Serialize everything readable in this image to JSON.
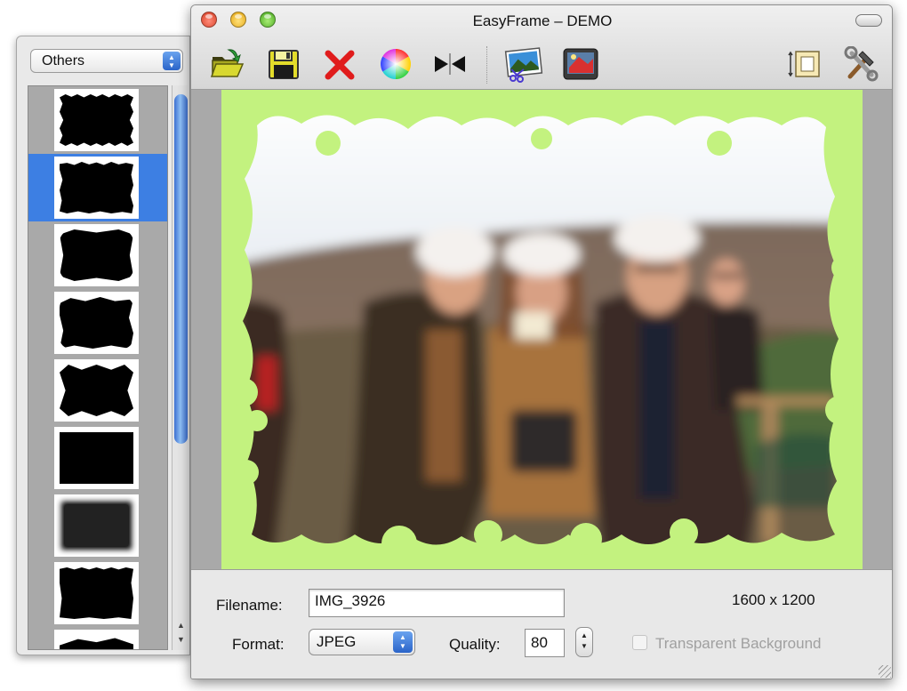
{
  "window": {
    "title": "EasyFrame – DEMO"
  },
  "drawer": {
    "category_selected": "Others",
    "frames": [
      {
        "name": "frame-thumb-1"
      },
      {
        "name": "frame-thumb-2",
        "selected": true
      },
      {
        "name": "frame-thumb-3"
      },
      {
        "name": "frame-thumb-4"
      },
      {
        "name": "frame-thumb-5"
      },
      {
        "name": "frame-thumb-6"
      },
      {
        "name": "frame-thumb-7"
      },
      {
        "name": "frame-thumb-8"
      },
      {
        "name": "frame-thumb-9"
      }
    ]
  },
  "toolbar": {
    "icons": [
      "open-folder-icon",
      "save-disk-icon",
      "delete-x-icon",
      "color-wheel-icon",
      "flip-icon",
      "photo-icon",
      "export-icon",
      "resize-icon",
      "preferences-tools-icon"
    ]
  },
  "form": {
    "filename_label": "Filename:",
    "filename_value": "IMG_3926",
    "dimensions": "1600 x 1200",
    "format_label": "Format:",
    "format_value": "JPEG",
    "quality_label": "Quality:",
    "quality_value": "80",
    "transparent_label": "Transparent Background",
    "transparent_checked": false
  },
  "colors": {
    "frame_green": "#c3f27f",
    "selection_blue": "#3d7fe3"
  }
}
